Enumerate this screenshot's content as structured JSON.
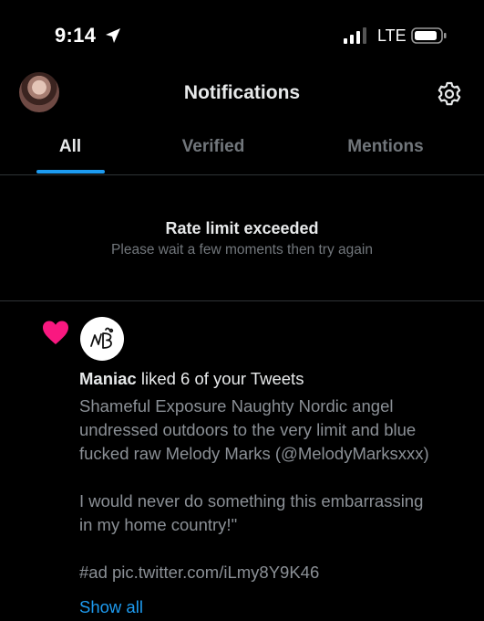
{
  "status_bar": {
    "time": "9:14",
    "network": "LTE",
    "icons": [
      "location-arrow-icon",
      "signal-icon",
      "battery-icon"
    ]
  },
  "header": {
    "title": "Notifications",
    "avatar_icon": "profile-avatar",
    "settings_icon": "gear-icon"
  },
  "tabs": [
    {
      "label": "All",
      "active": true
    },
    {
      "label": "Verified",
      "active": false
    },
    {
      "label": "Mentions",
      "active": false
    }
  ],
  "rate_limit": {
    "title": "Rate limit exceeded",
    "subtitle": "Please wait a few moments then try again"
  },
  "notification": {
    "type_icon": "heart-icon",
    "actor": "Maniac",
    "action": " liked 6 of your Tweets",
    "tweet_text": "Shameful Exposure Naughty Nordic angel\nundressed outdoors to the very limit and blue\nfucked raw Melody Marks (@MelodyMarksxxx)\n\nI would never do something this embarrassing\nin my home country!\"\n\n#ad pic.twitter.com/iLmy8Y9K46",
    "show_all_label": "Show all"
  },
  "colors": {
    "background": "#000000",
    "accent": "#1d9bf0",
    "heart": "#f91880",
    "muted_text": "#71767b",
    "divider": "#2f3336"
  }
}
